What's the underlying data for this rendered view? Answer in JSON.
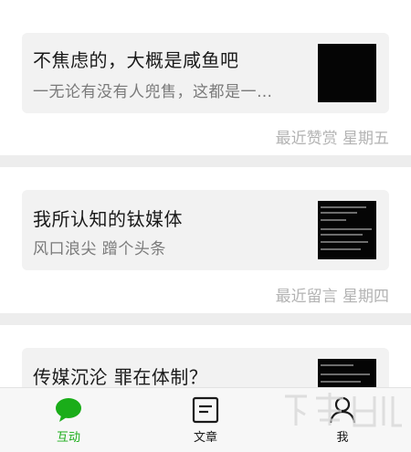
{
  "feed": {
    "items": [
      {
        "title": "不焦虑的，大概是咸鱼吧",
        "subtitle": "一无论有没有人兜售，这都是一…",
        "meta": "最近赞赏 星期五"
      },
      {
        "title": "我所认知的钛媒体",
        "subtitle": "风口浪尖 蹭个头条",
        "meta": "最近留言 星期四"
      },
      {
        "title": "传媒沉沦 罪在体制？",
        "subtitle": "",
        "meta": ""
      }
    ]
  },
  "tabbar": {
    "tabs": [
      {
        "label": "互动",
        "icon": "chat-bubble-icon",
        "active": true
      },
      {
        "label": "文章",
        "icon": "document-icon",
        "active": false
      },
      {
        "label": "我",
        "icon": "person-icon",
        "active": false
      }
    ]
  },
  "colors": {
    "accent": "#1aad19",
    "background": "#ededed",
    "card": "#f2f2f2",
    "meta_text": "#b3b3b3"
  }
}
